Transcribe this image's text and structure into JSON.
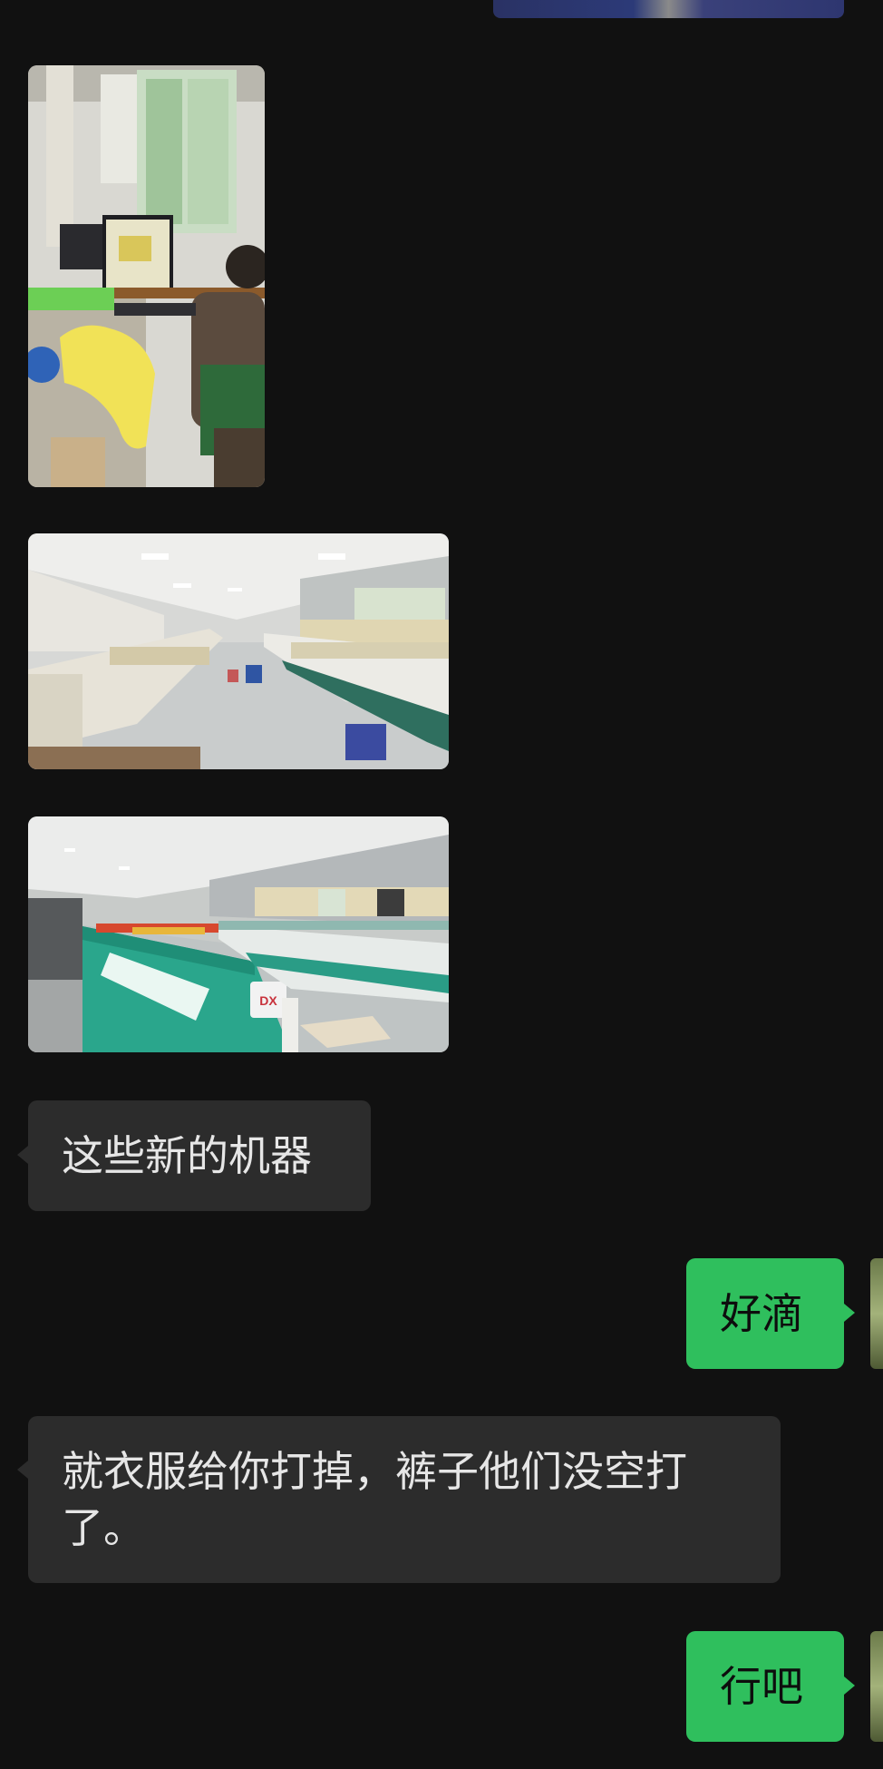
{
  "chat": {
    "messages": [
      {
        "type": "image",
        "direction": "in",
        "content": "photo-office-desk"
      },
      {
        "type": "image",
        "direction": "in",
        "content": "photo-factory-floor"
      },
      {
        "type": "image",
        "direction": "in",
        "content": "photo-embroidery-machines"
      },
      {
        "type": "text",
        "direction": "in",
        "text": "这些新的机器"
      },
      {
        "type": "text",
        "direction": "out",
        "text": "好滴"
      },
      {
        "type": "text",
        "direction": "in",
        "text": "就衣服给你打掉，裤子他们没空打了。"
      },
      {
        "type": "text",
        "direction": "out",
        "text": "行吧"
      }
    ],
    "msg_new_machines": "这些新的机器",
    "msg_ok_1": "好滴",
    "msg_clothes_line1": "就衣服给你打掉，裤子他们没空打",
    "msg_clothes_line2": "了。",
    "msg_ok_2": "行吧"
  },
  "colors": {
    "background": "#111111",
    "incoming_bubble": "#2c2c2c",
    "outgoing_bubble": "#2fbf5d",
    "incoming_text": "#e6e6e6",
    "outgoing_text": "#0d0d0d"
  }
}
